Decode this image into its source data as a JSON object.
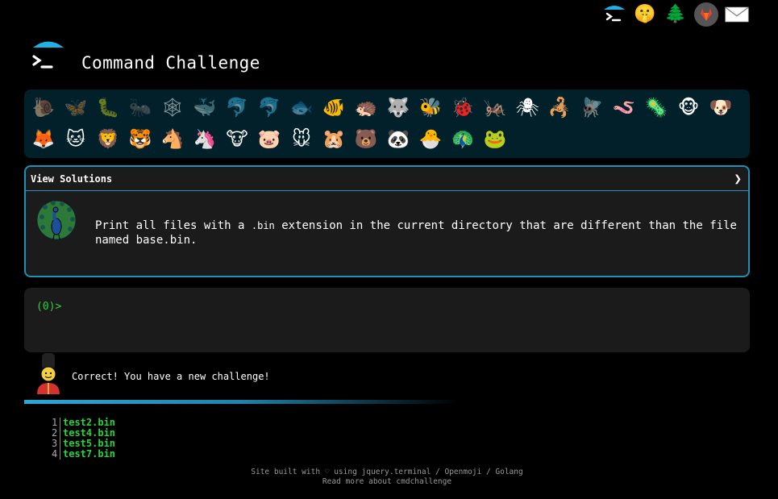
{
  "header": {
    "title": "Command Challenge",
    "top_icons": [
      {
        "name": "terminal-umbrella-icon",
        "glyph": ""
      },
      {
        "name": "shushing-face-icon",
        "glyph": "🤫"
      },
      {
        "name": "tree-icon",
        "glyph": "🌲"
      },
      {
        "name": "gitlab-icon",
        "glyph": ""
      },
      {
        "name": "envelope-icon",
        "glyph": "✉"
      }
    ]
  },
  "challenges": [
    {
      "emoji": "🐌",
      "done": true
    },
    {
      "emoji": "🦋",
      "done": true
    },
    {
      "emoji": "🐛",
      "done": true
    },
    {
      "emoji": "🐜",
      "done": true
    },
    {
      "emoji": "🕸",
      "done": true
    },
    {
      "emoji": "🐳",
      "done": true
    },
    {
      "emoji": "🐬",
      "done": true
    },
    {
      "emoji": "🐬",
      "done": true
    },
    {
      "emoji": "🐟",
      "done": true
    },
    {
      "emoji": "🐠",
      "done": false
    },
    {
      "emoji": "🦔",
      "done": false
    },
    {
      "emoji": "🐺",
      "done": false
    },
    {
      "emoji": "🐝",
      "done": false
    },
    {
      "emoji": "🐞",
      "done": false
    },
    {
      "emoji": "🦗",
      "done": false
    },
    {
      "emoji": "🕷",
      "done": false
    },
    {
      "emoji": "🦂",
      "done": false
    },
    {
      "emoji": "🪰",
      "done": false
    },
    {
      "emoji": "🪱",
      "done": false
    },
    {
      "emoji": "🦠",
      "done": false
    },
    {
      "emoji": "🐵",
      "done": false
    },
    {
      "emoji": "🐶",
      "done": false
    },
    {
      "emoji": "🦊",
      "done": false
    },
    {
      "emoji": "🐱",
      "done": false
    },
    {
      "emoji": "🦁",
      "done": false
    },
    {
      "emoji": "🐯",
      "done": false
    },
    {
      "emoji": "🐴",
      "done": false
    },
    {
      "emoji": "🦄",
      "done": false
    },
    {
      "emoji": "🐮",
      "done": false
    },
    {
      "emoji": "🐷",
      "done": false
    },
    {
      "emoji": "🐭",
      "done": false
    },
    {
      "emoji": "🐹",
      "done": false
    },
    {
      "emoji": "🐻",
      "done": false
    },
    {
      "emoji": "🐼",
      "done": false
    },
    {
      "emoji": "🐣",
      "done": false
    },
    {
      "emoji": "🦚",
      "done": false
    },
    {
      "emoji": "🐸",
      "done": false
    }
  ],
  "challenge": {
    "view_solutions": "View Solutions",
    "chevron": "❯",
    "desc_before": "Print all files with a ",
    "desc_code": ".bin",
    "desc_after": " extension in the current directory that are different than the file named base.bin."
  },
  "terminal": {
    "prompt": "(0)>"
  },
  "feedback": {
    "message": "Correct! You have a new challenge!"
  },
  "output": [
    {
      "line": "1",
      "text": "test2.bin"
    },
    {
      "line": "2",
      "text": "test4.bin"
    },
    {
      "line": "3",
      "text": "test5.bin"
    },
    {
      "line": "4",
      "text": "test7.bin"
    }
  ],
  "footer": {
    "line1": "Site built with ♡ using jquery.terminal / Openmoji / Golang",
    "line2": "Read more about cmdchallenge"
  },
  "colors": {
    "accent": "#1e8fb8",
    "green": "#29d33a",
    "panel": "#1b1b1b",
    "grid_bg": "#01202a"
  }
}
